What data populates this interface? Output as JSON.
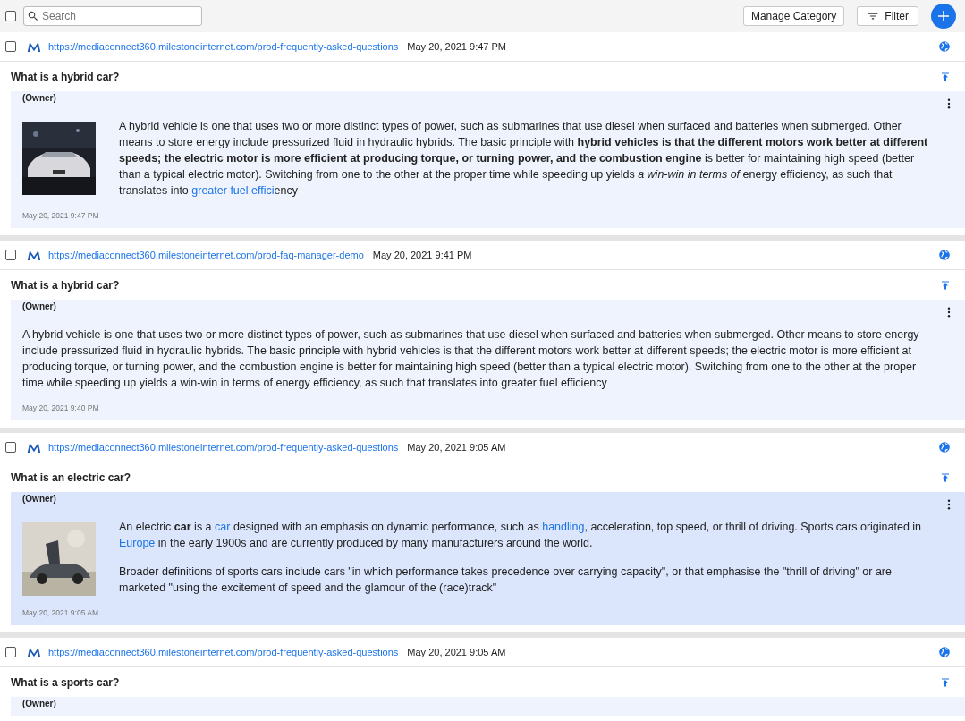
{
  "toolbar": {
    "search": {
      "placeholder": "Search"
    },
    "select_all": {
      "checked": false
    },
    "buttons": [
      {
        "label": "Manage Category",
        "kind": "plain"
      },
      {
        "label": "Filter",
        "kind": "filter"
      }
    ]
  },
  "items": [
    {
      "checked": false,
      "url": "https://mediaconnect360.milestoneinternet.com/prod-frequently-asked-questions",
      "date": "May 20, 2021 9:47 PM",
      "question": "What is a hybrid car?",
      "highlighted": false,
      "answer": {
        "author": "(Owner)",
        "image": {
          "kind": "picture"
        },
        "paragraphs": [
          [
            {
              "kind": "plain",
              "text": "A hybrid vehicle is one that uses two or more distinct types of power, such as submarines that use diesel when surfaced and batteries when submerged. Other means to store energy include pressurized fluid in hydraulic hybrids. The basic principle with "
            },
            {
              "kind": "bold",
              "text": "hybrid vehicles is that the different motors work better at different speeds; the electric motor is more efficient at producing torque, or turning power, and the combustion engine"
            },
            {
              "kind": "plain",
              "text": " is better for maintaining high speed (better than a typical electric motor). Switching from one to the other at the proper time while speeding up yields "
            },
            {
              "kind": "italic",
              "text": "a win-win in terms of "
            },
            {
              "kind": "plain",
              "text": "energy efficiency, as such that translates into "
            },
            {
              "kind": "link",
              "text": "greater fuel effici"
            },
            {
              "kind": "plain",
              "text": "ency"
            }
          ]
        ],
        "date": "May 20, 2021 9:47 PM"
      }
    },
    {
      "checked": false,
      "url": "https://mediaconnect360.milestoneinternet.com/prod-faq-manager-demo",
      "date": "May 20, 2021 9:41 PM",
      "question": "What is a hybrid car?",
      "highlighted": false,
      "answer": {
        "author": "(Owner)",
        "paragraphs": [
          [
            {
              "kind": "plain",
              "text": "A hybrid vehicle is one that uses two or more distinct types of power, such as submarines that use diesel when surfaced and batteries when submerged. Other means to store energy include pressurized fluid in hydraulic hybrids. The basic principle with hybrid vehicles is that the different motors work better at different speeds; the electric motor is more efficient at producing torque, or turning power, and the combustion engine is better for maintaining high speed (better than a typical electric motor). Switching from one to the other at the proper time while speeding up yields a win-win in terms of energy efficiency, as such that translates into greater fuel efficiency"
            }
          ]
        ],
        "date": "May 20, 2021 9:40 PM"
      }
    },
    {
      "checked": false,
      "url": "https://mediaconnect360.milestoneinternet.com/prod-frequently-asked-questions",
      "date": "May 20, 2021 9:05 AM",
      "question": "What is an electric car?",
      "highlighted": true,
      "answer": {
        "author": "(Owner)",
        "image": {
          "kind": "picture"
        },
        "paragraphs": [
          [
            {
              "kind": "plain",
              "text": "An electric "
            },
            {
              "kind": "bold",
              "text": "car"
            },
            {
              "kind": "plain",
              "text": " is a "
            },
            {
              "kind": "link",
              "text": "car"
            },
            {
              "kind": "plain",
              "text": " designed with an emphasis on dynamic performance, such as "
            },
            {
              "kind": "link",
              "text": "handling"
            },
            {
              "kind": "plain",
              "text": ", acceleration, top speed, or thrill of driving. Sports cars originated in "
            },
            {
              "kind": "link",
              "text": "Europe"
            },
            {
              "kind": "plain",
              "text": " in the early 1900s and are currently produced by many manufacturers around the world."
            }
          ],
          [
            {
              "kind": "plain",
              "text": "Broader definitions of sports cars include cars \"in which performance takes precedence over carrying capacity\", or that emphasise the \"thrill of driving\" or are marketed \"using the excitement of speed and the glamour of the (race)track\""
            }
          ]
        ],
        "date": "May 20, 2021 9:05 AM"
      }
    },
    {
      "checked": false,
      "url": "https://mediaconnect360.milestoneinternet.com/prod-frequently-asked-questions",
      "date": "May 20, 2021 9:05 AM",
      "question": "What is a sports car?",
      "highlighted": false,
      "answer": {
        "author": "(Owner)"
      }
    }
  ]
}
